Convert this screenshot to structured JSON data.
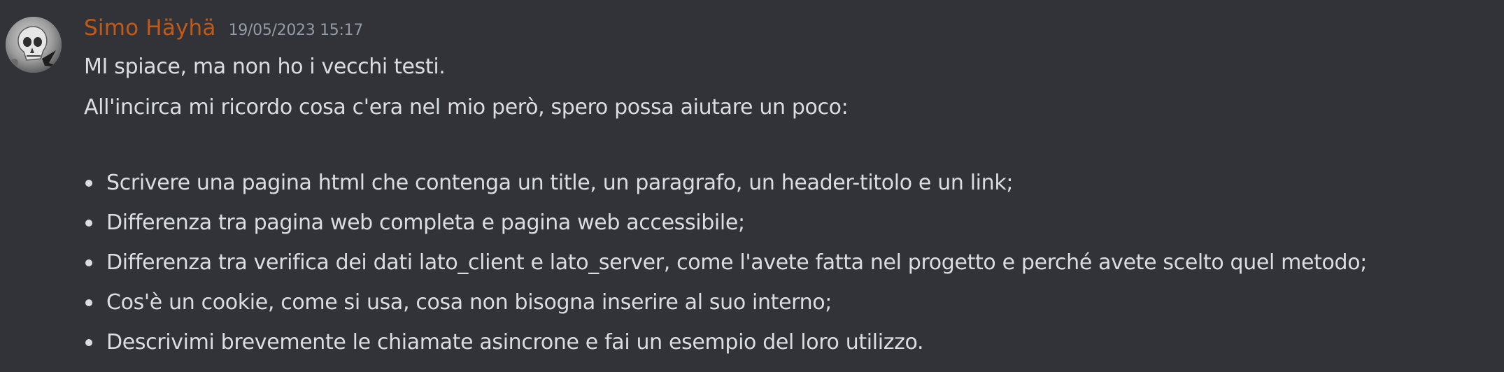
{
  "message": {
    "author": "Simo Häyhä",
    "timestamp": "19/05/2023 15:17",
    "avatar_icon": "skull-avatar-icon",
    "author_color": "#c25a17",
    "lines": [
      "MI spiace, ma non ho i vecchi testi.",
      "All'incirca mi ricordo cosa c'era nel mio però, spero possa aiutare un poco:"
    ],
    "bullets": [
      "Scrivere una pagina html che contenga un title, un paragrafo, un header-titolo e un link;",
      "Differenza tra pagina web completa e pagina web accessibile;",
      "Differenza tra verifica dei dati lato_client e lato_server, come l'avete fatta nel progetto e perché avete scelto quel metodo;",
      "Cos'è un cookie, come si usa, cosa non bisogna inserire al suo interno;",
      "Descrivimi brevemente le chiamate asincrone e fai un esempio del loro utilizzo."
    ]
  }
}
